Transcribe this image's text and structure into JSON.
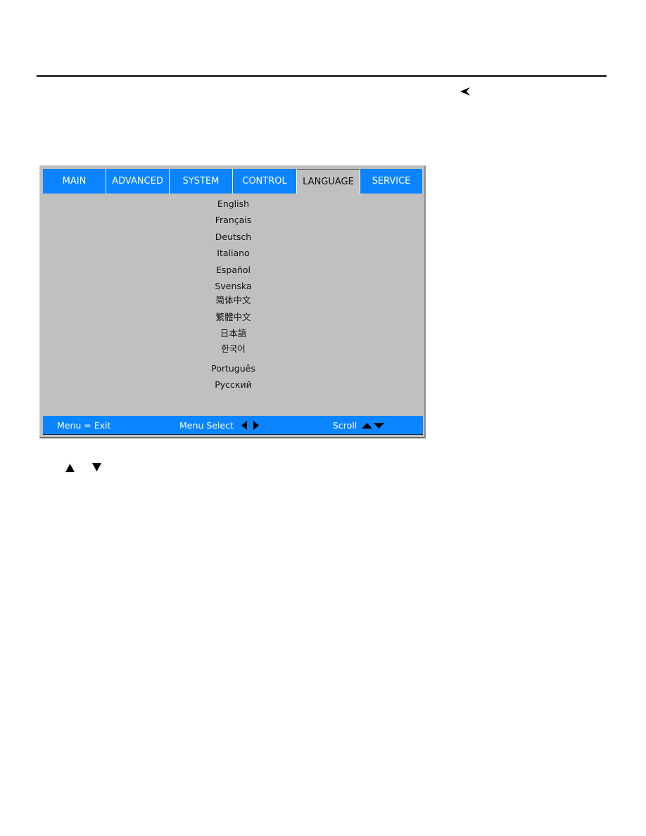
{
  "osd_menu": {
    "tabs": [
      {
        "label": "MAIN",
        "selected": false
      },
      {
        "label": "ADVANCED",
        "selected": false
      },
      {
        "label": "SYSTEM",
        "selected": false
      },
      {
        "label": "CONTROL",
        "selected": false
      },
      {
        "label": "LANGUAGE",
        "selected": true
      },
      {
        "label": "SERVICE",
        "selected": false
      }
    ],
    "languages": [
      "English",
      "Français",
      "Deutsch",
      "Italiano",
      "Español",
      "Svenska",
      "简体中文",
      "繁體中文",
      "日本語",
      "한국어",
      "Português",
      "Русский"
    ],
    "footer": {
      "exit_hint": "Menu = Exit",
      "select_hint": "Menu Select",
      "scroll_hint": "Scroll",
      "select_icons": "left-right-arrows",
      "scroll_icons": "up-down-arrows"
    }
  },
  "colors": {
    "tab_blue": "#0a84ff",
    "menu_gray": "#c0c0c0",
    "selected_tab_text": "#111111",
    "tab_text": "#ffffff"
  }
}
